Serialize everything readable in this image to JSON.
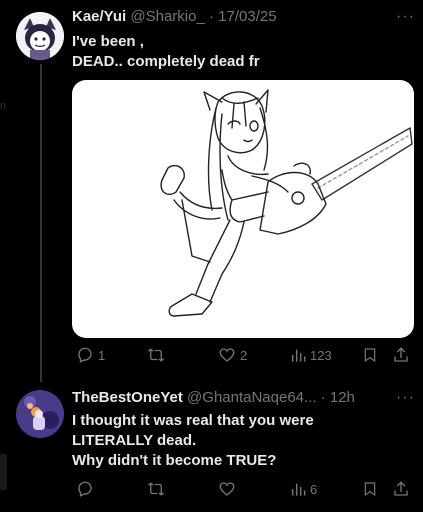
{
  "post1": {
    "display_name": "Kae/Yui",
    "handle": "@Sharkio_",
    "separator": "·",
    "date": "17/03/25",
    "more": "···",
    "text_lines": [
      "I've been ,",
      "DEAD.. completely dead fr"
    ],
    "stats": {
      "replies": "1",
      "reposts": "",
      "likes": "2",
      "views": "123"
    }
  },
  "post2": {
    "display_name": "TheBestOneYet",
    "handle": "@GhantaNaqe64...",
    "separator": "·",
    "time": "12h",
    "more": "···",
    "text_lines": [
      "I thought it was real that you were",
      "LITERALLY dead.",
      "Why didn't it become TRUE?"
    ],
    "stats": {
      "replies": "",
      "reposts": "",
      "likes": "",
      "views": "6"
    }
  },
  "icons": [
    "reply-icon",
    "repost-icon",
    "like-icon",
    "views-icon",
    "bookmark-icon",
    "share-icon",
    "more-icon"
  ],
  "colors": {
    "background": "#000000",
    "text": "#e7e9ea",
    "muted": "#71767b"
  }
}
